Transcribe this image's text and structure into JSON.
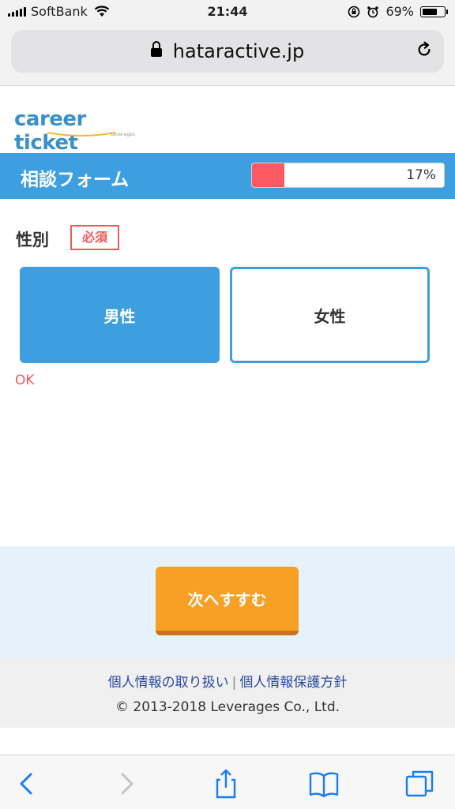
{
  "status_bar": {
    "carrier": "SoftBank",
    "time": "21:44",
    "battery": "69%",
    "battery_level": 0.69
  },
  "browser": {
    "url": "hataractive.jp"
  },
  "logo": {
    "text": "career ticket",
    "sub": "Leverages"
  },
  "form": {
    "title": "相談フォーム",
    "progress_label": "17%",
    "progress_value": 0.17,
    "question": {
      "label": "性別",
      "required_badge": "必須",
      "options": [
        "男性",
        "女性"
      ],
      "selected": "男性",
      "validation": "OK"
    },
    "next_button": "次へすすむ"
  },
  "footer": {
    "link1": "個人情報の取り扱い",
    "separator": "|",
    "link2": "個人情報保護方針",
    "copyright": "© 2013-2018 Leverages Co., Ltd."
  },
  "colors": {
    "accent": "#3d9fe0",
    "progress_fill": "#ff5a64",
    "required": "#ef5a5a",
    "cta": "#f7a024"
  },
  "toolbar_icons": [
    "back-icon",
    "forward-icon",
    "share-icon",
    "bookmarks-icon",
    "tabs-icon"
  ]
}
